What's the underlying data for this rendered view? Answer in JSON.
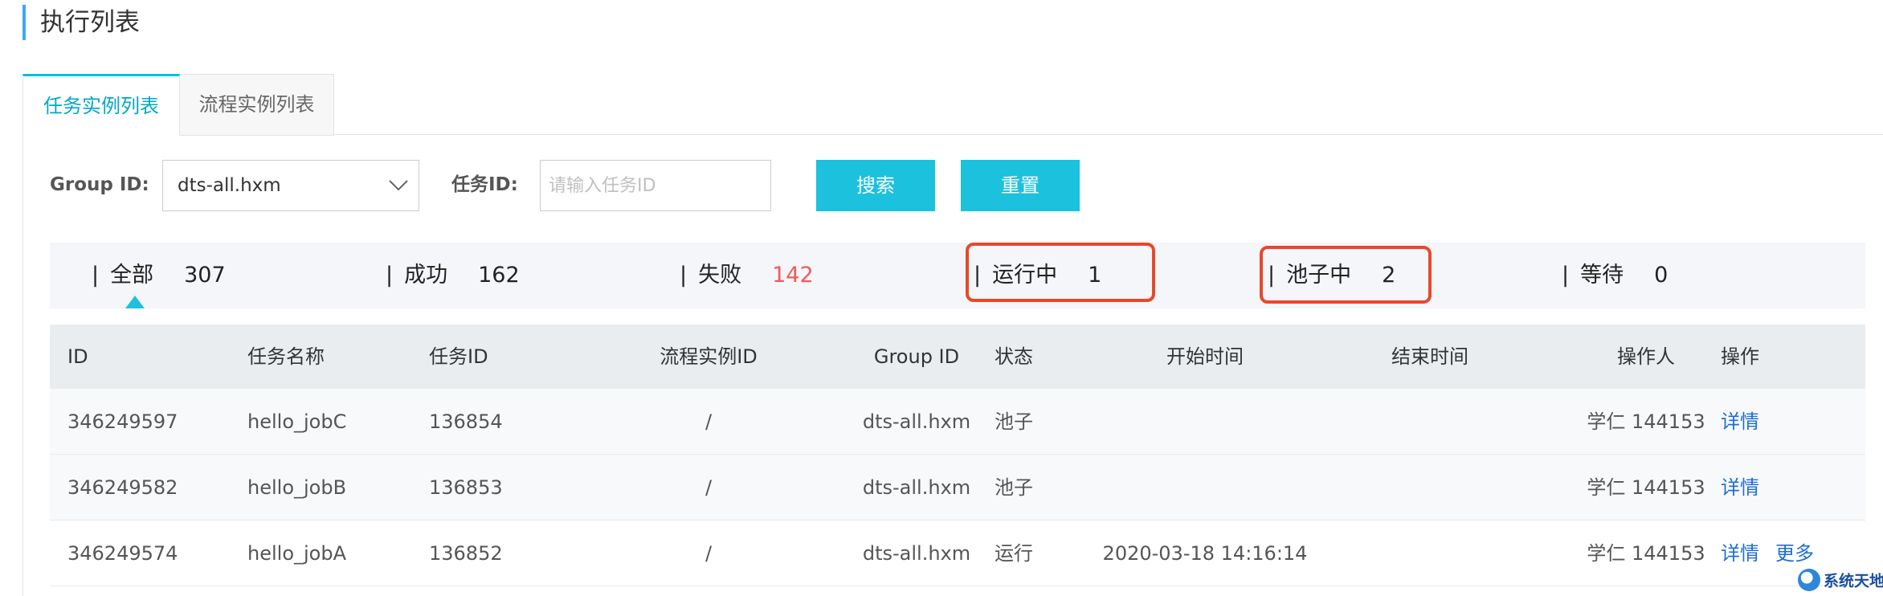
{
  "page": {
    "title": "执行列表"
  },
  "tabs": [
    {
      "label": "任务实例列表",
      "active": true
    },
    {
      "label": "流程实例列表",
      "active": false
    }
  ],
  "filters": {
    "group_label": "Group ID:",
    "group_value": "dts-all.hxm",
    "task_label": "任务ID:",
    "task_placeholder": "请输入任务ID",
    "search_label": "搜索",
    "reset_label": "重置"
  },
  "status_summary": [
    {
      "name": "全部",
      "count": "307"
    },
    {
      "name": "成功",
      "count": "162"
    },
    {
      "name": "失败",
      "count": "142"
    },
    {
      "name": "运行中",
      "count": "1"
    },
    {
      "name": "池子中",
      "count": "2"
    },
    {
      "name": "等待",
      "count": "0"
    }
  ],
  "table": {
    "headers": [
      "ID",
      "任务名称",
      "任务ID",
      "流程实例ID",
      "Group ID",
      "状态",
      "开始时间",
      "结束时间",
      "操作人",
      "操作"
    ],
    "rows": [
      {
        "id": "346249597",
        "name": "hello_jobC",
        "task_id": "136854",
        "flow_id": "/",
        "group": "dts-all.hxm",
        "status": "池子",
        "start": "",
        "end": "",
        "operator": "学仁 144153",
        "actions": [
          "详情"
        ]
      },
      {
        "id": "346249582",
        "name": "hello_jobB",
        "task_id": "136853",
        "flow_id": "/",
        "group": "dts-all.hxm",
        "status": "池子",
        "start": "",
        "end": "",
        "operator": "学仁 144153",
        "actions": [
          "详情"
        ]
      },
      {
        "id": "346249574",
        "name": "hello_jobA",
        "task_id": "136852",
        "flow_id": "/",
        "group": "dts-all.hxm",
        "status": "运行",
        "start": "2020-03-18 14:16:14",
        "end": "",
        "operator": "学仁 144153",
        "actions": [
          "详情",
          "更多"
        ]
      }
    ]
  },
  "watermark": {
    "text": "系统天地"
  },
  "colors": {
    "accent": "#1cc1dd",
    "link": "#1f6dd4",
    "fail": "#f05a5a",
    "highlight": "#e9482a"
  }
}
